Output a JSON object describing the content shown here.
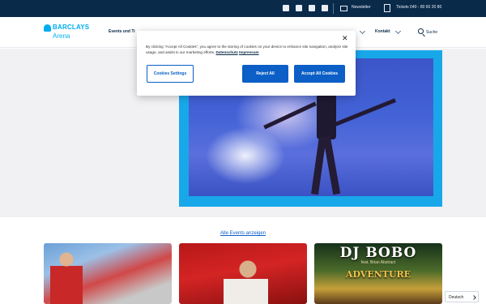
{
  "topbar": {
    "social_icons": [
      "instagram-icon",
      "facebook-icon",
      "x-icon",
      "tiktok-icon"
    ],
    "newsletter_label": "Newsletter",
    "tickets_label": "Tickets 040 - 80 60 20 80"
  },
  "header": {
    "logo_brand": "BARCLAYS",
    "logo_sub": "Arena",
    "nav": [
      {
        "label": "Events und Ti"
      },
      {
        "label": "Kontakt"
      }
    ],
    "search_label": "Suche"
  },
  "cookie_banner": {
    "text": "By clicking “Accept All Cookies”, you agree to the storing of cookies on your device to enhance site navigation, analyze site usage, and assist in our marketing efforts.",
    "link_privacy": "Datenschutz",
    "link_imprint": "Impressum",
    "settings_label": "Cookies Settings",
    "reject_label": "Reject All",
    "accept_label": "Accept All Cookies",
    "close_icon": "close-icon"
  },
  "events": {
    "all_events_label": "Alle Events anzeigen",
    "cards": [
      {
        "id": "card-1"
      },
      {
        "id": "card-2"
      },
      {
        "id": "card-3",
        "title": "DJ BOBO",
        "subtitle": "feat. Brian Abstract",
        "sub_title": "ADVENTURE"
      }
    ]
  },
  "language": {
    "selected": "Deutsch"
  },
  "colors": {
    "topbar": "#0a2a4a",
    "accent": "#00aeef",
    "button": "#0b5fc6",
    "hero_frame": "#18a8ea"
  }
}
